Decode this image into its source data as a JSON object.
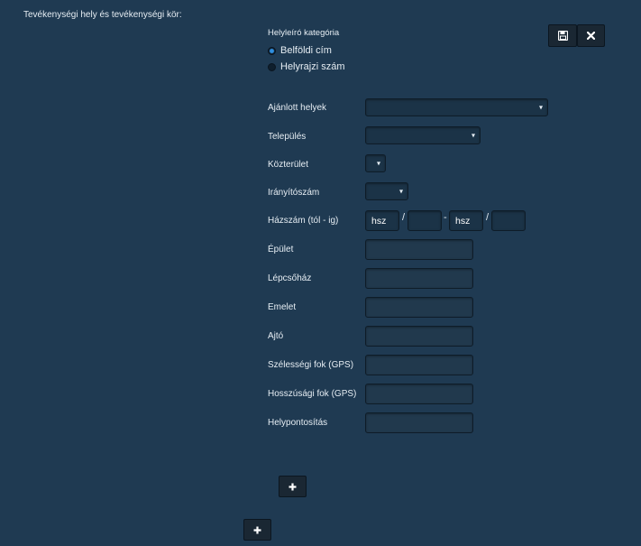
{
  "section": {
    "title": "Tevékenységi hely és tevékenységi kör:"
  },
  "category": {
    "label": "Helyleíró kategória",
    "options": [
      {
        "label": "Belföldi cím",
        "selected": true
      },
      {
        "label": "Helyrajzi szám",
        "selected": false
      }
    ]
  },
  "fields": {
    "ajanlott": {
      "label": "Ajánlott helyek",
      "value": ""
    },
    "telepules": {
      "label": "Település",
      "value": ""
    },
    "kozterulet": {
      "label": "Közterület",
      "value": ""
    },
    "iranyitoszam": {
      "label": "Irányítószám",
      "value": ""
    },
    "hazszam": {
      "label": "Házszám (tól - ig)",
      "from_prefix": "hsz",
      "separator1": "/",
      "dash": "-",
      "to_prefix": "hsz",
      "separator2": "/"
    },
    "epulet": {
      "label": "Épület",
      "value": ""
    },
    "lepcsohaz": {
      "label": "Lépcsőház",
      "value": ""
    },
    "emelet": {
      "label": "Emelet",
      "value": ""
    },
    "ajto": {
      "label": "Ajtó",
      "value": ""
    },
    "szelesseg": {
      "label": "Szélességi fok (GPS)",
      "value": ""
    },
    "hosszusag": {
      "label": "Hosszúsági fok (GPS)",
      "value": ""
    },
    "helypontositas": {
      "label": "Helypontosítás",
      "value": ""
    }
  },
  "icons": {
    "save": "save-icon",
    "close": "close-icon",
    "add": "plus-icon"
  },
  "colors": {
    "background": "#1f3a52",
    "input": "#1b3347",
    "button": "#1a2733",
    "radio_selected": "#2f8fe0"
  }
}
